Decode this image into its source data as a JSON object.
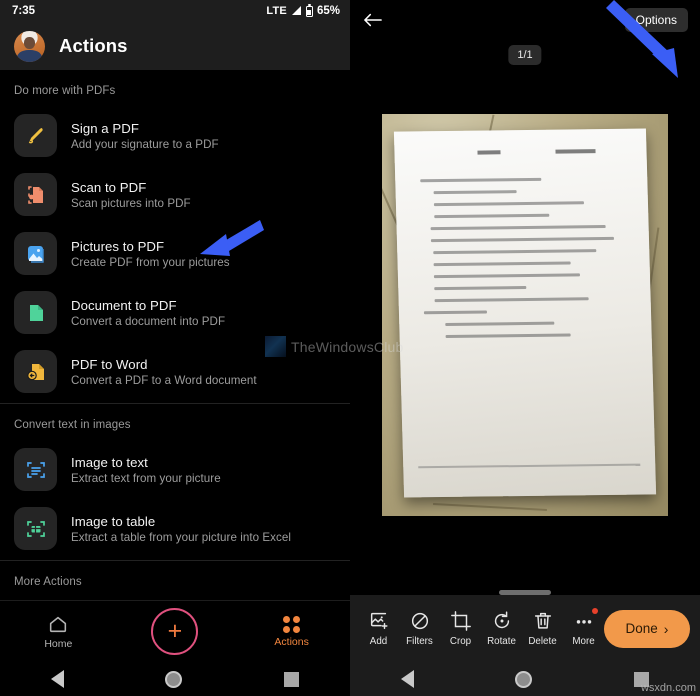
{
  "left": {
    "status_bar": {
      "time": "7:35",
      "network": "LTE",
      "battery": "65%"
    },
    "app_bar": {
      "title": "Actions",
      "avatar_name": "user-avatar"
    },
    "sections": [
      {
        "header": "Do more with PDFs",
        "items": [
          {
            "title": "Sign a PDF",
            "subtitle": "Add your signature to a PDF",
            "icon": "pen-icon",
            "color": "#f0c040"
          },
          {
            "title": "Scan to PDF",
            "subtitle": "Scan pictures into PDF",
            "icon": "scan-document-icon",
            "color": "#ef8d6c"
          },
          {
            "title": "Pictures to PDF",
            "subtitle": "Create PDF from your pictures",
            "icon": "image-icon",
            "color": "#4aa3ef"
          },
          {
            "title": "Document to PDF",
            "subtitle": "Convert a document into PDF",
            "icon": "document-icon",
            "color": "#4fd39a"
          },
          {
            "title": "PDF to Word",
            "subtitle": "Convert a PDF to a Word document",
            "icon": "pdf-to-word-icon",
            "color": "#f0b63c"
          }
        ]
      },
      {
        "header": "Convert text in images",
        "items": [
          {
            "title": "Image to text",
            "subtitle": "Extract text from your picture",
            "icon": "scan-text-icon",
            "color": "#4aa3ef"
          },
          {
            "title": "Image to table",
            "subtitle": "Extract a table from your picture into Excel",
            "icon": "scan-table-icon",
            "color": "#4fd39a"
          }
        ]
      },
      {
        "header": "More Actions",
        "items": []
      }
    ],
    "bottom_nav": {
      "home_label": "Home",
      "actions_label": "Actions",
      "fab_label": "+",
      "active_color": "#f2863f",
      "inactive_color": "#b4b4b4",
      "fab_ring_color": "#e0517f"
    }
  },
  "right": {
    "back_label": "back",
    "options_label": "Options",
    "page_indicator": "1/1",
    "watermark": "TheWindowsClub",
    "corner_watermark": "wsxdn.com",
    "toolbar": [
      {
        "label": "Add",
        "icon": "add-image-icon",
        "badge": false
      },
      {
        "label": "Filters",
        "icon": "filters-icon",
        "badge": false
      },
      {
        "label": "Crop",
        "icon": "crop-icon",
        "badge": false
      },
      {
        "label": "Rotate",
        "icon": "rotate-icon",
        "badge": false
      },
      {
        "label": "Delete",
        "icon": "trash-icon",
        "badge": false
      },
      {
        "label": "More",
        "icon": "more-dots-icon",
        "badge": true
      }
    ],
    "done_label": "Done",
    "done_color": "#f2994a"
  },
  "annotations": {
    "arrow_color": "#3b5ef5",
    "arrow_one_target": "Pictures to PDF",
    "arrow_two_target": "Done"
  }
}
